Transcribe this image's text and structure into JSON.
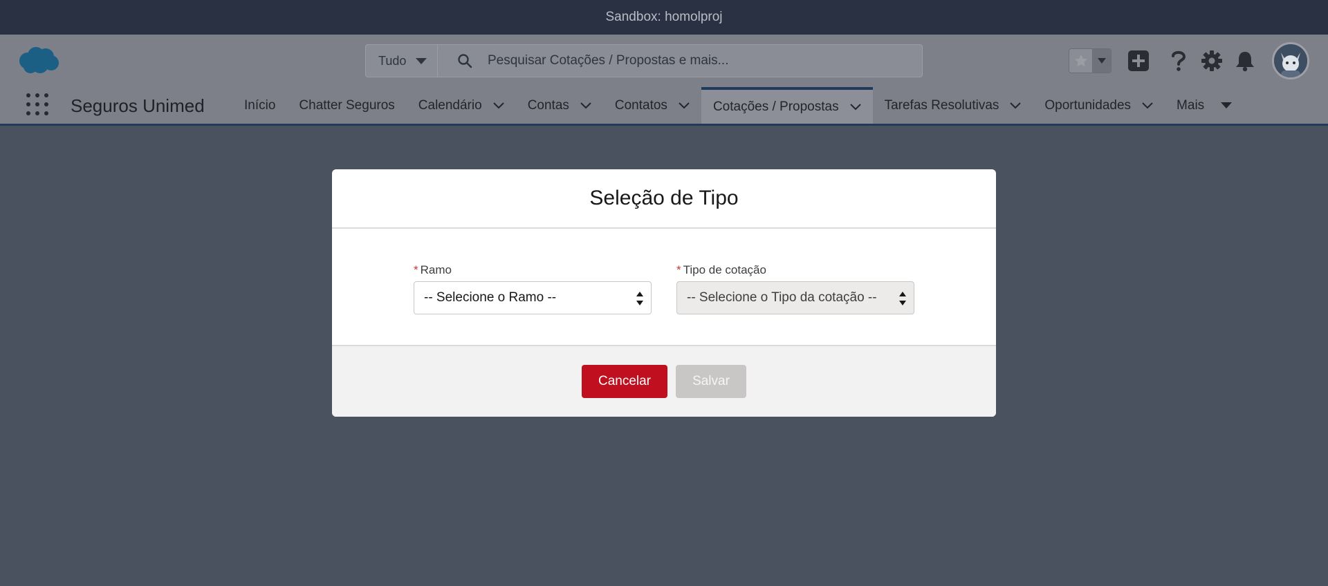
{
  "sandbox": {
    "label": "Sandbox: homolproj"
  },
  "header": {
    "scope": "Tudo",
    "search_placeholder": "Pesquisar Cotações / Propostas e mais...",
    "icons": [
      "salesforce-cloud-logo",
      "search-icon",
      "star-icon",
      "add-icon",
      "help-icon",
      "setup-gear-icon",
      "notification-bell-icon",
      "avatar"
    ]
  },
  "app_nav": {
    "app_name": "Seguros Unimed",
    "items": [
      {
        "label": "Início",
        "dropdown": false
      },
      {
        "label": "Chatter Seguros",
        "dropdown": false
      },
      {
        "label": "Calendário",
        "dropdown": true
      },
      {
        "label": "Contas",
        "dropdown": true
      },
      {
        "label": "Contatos",
        "dropdown": true
      },
      {
        "label": "Cotações / Propostas",
        "dropdown": true,
        "active": true
      },
      {
        "label": "Tarefas Resolutivas",
        "dropdown": true
      },
      {
        "label": "Oportunidades",
        "dropdown": true
      },
      {
        "label": "Mais",
        "dropdown": true
      }
    ]
  },
  "modal": {
    "title": "Seleção de Tipo",
    "ramo": {
      "label": "Ramo",
      "value": "-- Selecione o Ramo --",
      "required": true
    },
    "tipo": {
      "label": "Tipo de cotação",
      "value": "-- Selecione o Tipo da cotação --",
      "required": true,
      "disabled": true
    },
    "cancel_label": "Cancelar",
    "save_label": "Salvar"
  },
  "colors": {
    "overlay": "#4a5260",
    "brand_red": "#c0101f",
    "nav_active_border": "#1f3a5a"
  }
}
